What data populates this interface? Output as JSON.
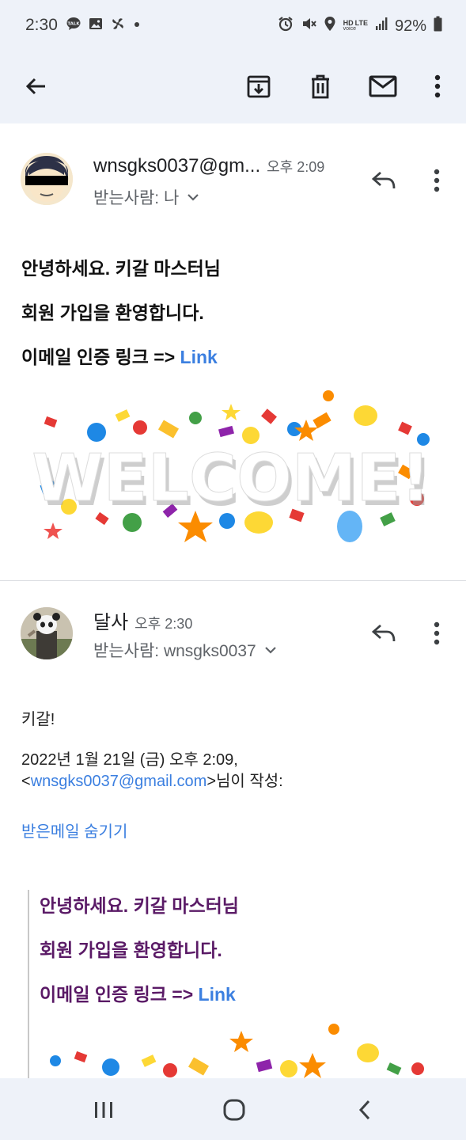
{
  "status_bar": {
    "time": "2:30",
    "net_hd": "HD",
    "net_voice": "voice",
    "net_lte": "LTE",
    "battery": "92%",
    "icons": [
      "talk-icon",
      "gallery-icon",
      "fan-icon",
      "dot-icon",
      "alarm-icon",
      "mute-icon",
      "location-icon",
      "signal-icon",
      "battery-icon"
    ]
  },
  "toolbar": {
    "icons": [
      "back-arrow-icon",
      "archive-icon",
      "delete-icon",
      "mark-unread-icon",
      "more-vert-icon"
    ]
  },
  "message1": {
    "sender": "wnsgks0037@gm...",
    "time": "오후 2:09",
    "recipient": "받는사람: 나",
    "line1": "안녕하세요. 키갈 마스터님",
    "line2": "회원 가입을 환영합니다.",
    "line3_prefix": "이메일 인증 링크 => ",
    "line3_link": "Link",
    "banner_text": "WELCOME!"
  },
  "message2": {
    "sender": "달사",
    "time": "오후 2:30",
    "recipient": "받는사람: wnsgks0037",
    "greeting": "키갈!",
    "quote_header_line1": "2022년 1월 21일 (금) 오후 2:09,",
    "quote_header_lt": "<",
    "quote_header_email": "wnsgks0037@gmail.com",
    "quote_header_suffix": ">님이 작성:",
    "hide_quoted": "받은메일 숨기기",
    "quoted_line1": "안녕하세요. 키갈 마스터님",
    "quoted_line2": "회원 가입을 환영합니다.",
    "quoted_line3_prefix": "이메일 인증 링크 => ",
    "quoted_line3_link": "Link"
  },
  "nav_bar": {
    "icons": [
      "recent-apps-icon",
      "home-icon",
      "back-icon"
    ]
  },
  "colors": {
    "chrome_bg": "#eef2f9",
    "link": "#3b7fe0",
    "quoted_text": "#5a1a66"
  }
}
